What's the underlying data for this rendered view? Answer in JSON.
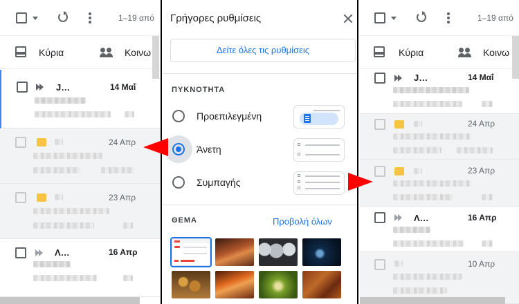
{
  "mail_left": {
    "count_text": "1–19 από",
    "tab_primary": "Κύρια",
    "tab_social": "Κοινω",
    "rows": [
      {
        "sender": "J…",
        "date": "14 Μαΐ"
      },
      {
        "sender": "",
        "date": "24 Απρ"
      },
      {
        "sender": "",
        "date": "23 Απρ"
      },
      {
        "sender": "Λ…",
        "date": "16 Απρ"
      }
    ]
  },
  "mail_right": {
    "count_text": "1–19 από",
    "tab_primary": "Κύρια",
    "tab_social": "Κοινω",
    "rows": [
      {
        "sender": "J…",
        "date": "14 Μαΐ"
      },
      {
        "sender": "",
        "date": "24 Απρ"
      },
      {
        "sender": "",
        "date": "23 Απρ"
      },
      {
        "sender": "Λ…",
        "date": "16 Απρ"
      },
      {
        "sender": "",
        "date": "10 Απρ"
      }
    ]
  },
  "quick_settings": {
    "title": "Γρήγορες ρυθμίσεις",
    "all_settings_button": "Δείτε όλες τις ρυθμίσεις",
    "density_heading": "ΠΥΚΝΟΤΗΤΑ",
    "density_options": [
      {
        "label": "Προεπιλεγμένη",
        "checked": false
      },
      {
        "label": "Άνετη",
        "checked": true
      },
      {
        "label": "Συμπαγής",
        "checked": false
      }
    ],
    "theme_heading": "ΘΕΜΑ",
    "view_all_link": "Προβολή όλων",
    "theme_thumbnail_colors": [
      "#ffffff",
      "#8a4a2a",
      "#3a3a3a",
      "#0a1a2a",
      "#6a4a2a",
      "#a84a1a",
      "#2a4a1a",
      "#7a3a1a"
    ]
  },
  "colors": {
    "accent": "#1a73e8",
    "annotation_arrow": "#ff0000",
    "unread_indicator": "#4285f4"
  }
}
